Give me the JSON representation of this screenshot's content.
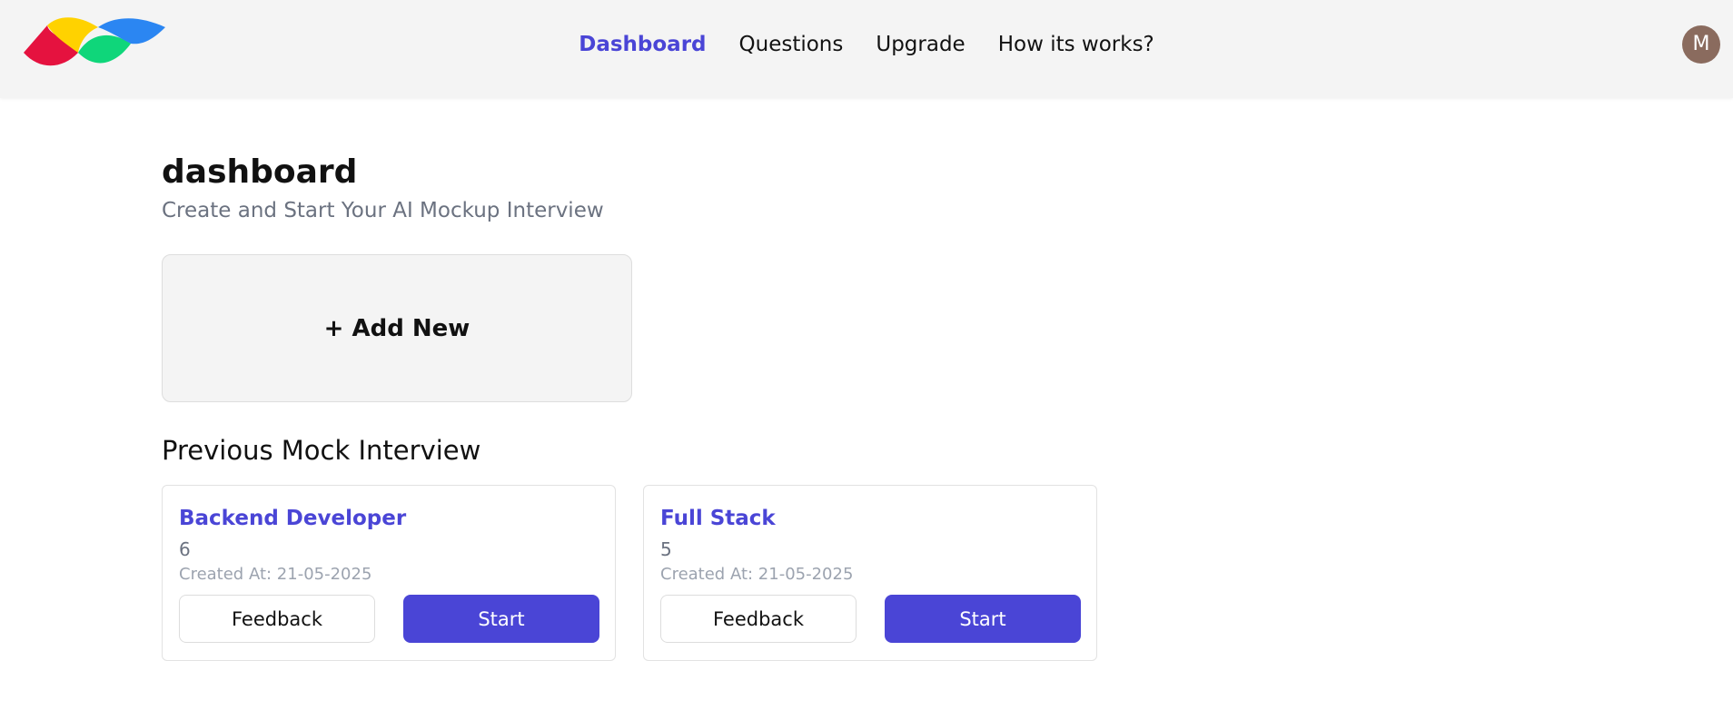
{
  "header": {
    "logo_icon": "logo-icon",
    "nav": [
      {
        "label": "Dashboard",
        "active": true
      },
      {
        "label": "Questions",
        "active": false
      },
      {
        "label": "Upgrade",
        "active": false
      },
      {
        "label": "How its works?",
        "active": false
      }
    ],
    "avatar_initial": "M"
  },
  "main": {
    "title": "dashboard",
    "subtitle": "Create and Start Your AI Mockup Interview",
    "add_new_label": "+ Add New",
    "section_title": "Previous Mock Interview",
    "interviews": [
      {
        "title": "Backend Developer",
        "count": "6",
        "created": "Created At: 21-05-2025",
        "feedback_label": "Feedback",
        "start_label": "Start"
      },
      {
        "title": "Full Stack",
        "count": "5",
        "created": "Created At: 21-05-2025",
        "feedback_label": "Feedback",
        "start_label": "Start"
      }
    ]
  },
  "colors": {
    "accent": "#4a45d6",
    "header_bg": "#f4f4f4",
    "avatar_bg": "#8a6b5e",
    "logo_red": "#e5123f",
    "logo_yellow": "#ffd200",
    "logo_green": "#0fd67a",
    "logo_blue": "#2b86f2"
  }
}
